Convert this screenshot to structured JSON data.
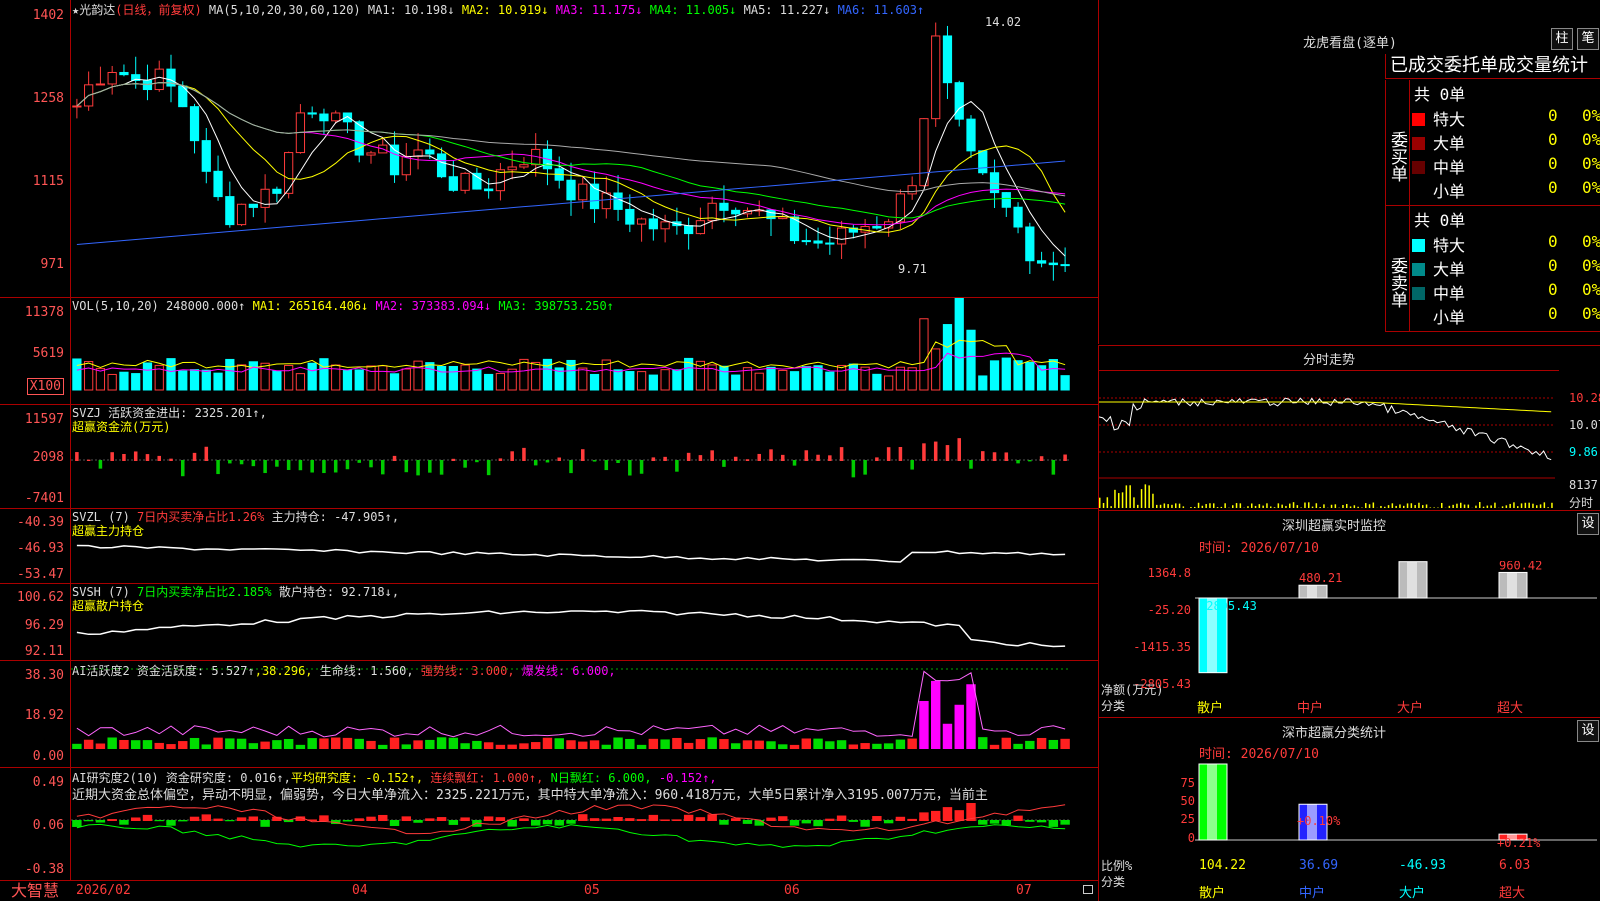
{
  "stock_title": "★光韵达",
  "period_note": "(日线，前复权)",
  "ma_header": {
    "label": "MA(5,10,20,30,60,120)",
    "ma1": "MA1: 10.198↓",
    "ma2": "MA2: 10.919↓",
    "ma3": "MA3: 11.175↓",
    "ma4": "MA4: 11.005↓",
    "ma5": "MA5: 11.227↓",
    "ma6": "MA6: 11.603↑"
  },
  "price_ticks": [
    "1402",
    "1258",
    "1115",
    "971"
  ],
  "price_high_label": "14.02",
  "price_low_label": "9.71",
  "vol_header": {
    "label": "VOL(5,10,20)",
    "vol": "248000.000↑",
    "ma1": "MA1: 265164.406↓",
    "ma2": "MA2: 373383.094↓",
    "ma3": "MA3: 398753.250↑"
  },
  "vol_ticks": [
    "11378",
    "5619",
    "X100"
  ],
  "svzj": {
    "line1": "SVZJ  活跃资金进出: 2325.201↑,",
    "line2": "超赢资金流(万元)",
    "ticks": [
      "11597",
      "2098",
      "-7401"
    ]
  },
  "svzl": {
    "label": "SVZL (7)",
    "ratio": "7日内买卖净占比1.26%",
    "value": "主力持仓: -47.905↑,",
    "line2": "超赢主力持仓",
    "ticks": [
      "-40.39",
      "-46.93",
      "-53.47"
    ]
  },
  "svsh": {
    "label": "SVSH (7)",
    "ratio": "7日内买卖净占比2.185%",
    "value": "散户持仓: 92.718↓,",
    "line2": "超赢散户持仓",
    "ticks": [
      "100.62",
      "96.29",
      "92.11"
    ]
  },
  "ai_active": {
    "label": "AI活跃度2",
    "v1": "资金活跃度: 5.527↑",
    "v2": ",38.296,",
    "v3": "生命线: 1.560,",
    "v4": "强势线: 3.000,",
    "v5": "爆发线: 6.000,",
    "ticks": [
      "38.30",
      "18.92",
      "0.00"
    ]
  },
  "ai_research": {
    "label": "AI研究度2(10)",
    "v1": "资金研究度: 0.016↑,",
    "v2": "平均研究度: -0.152↑,",
    "v3": "连续飘红: 1.000↑,",
    "v4": "N日飘红: 6.000,",
    "v5": "-0.152↑,",
    "summary": "近期大资金总体偏空，异动不明显，偏弱势，今日大单净流入：2325.221万元，其中特大单净流入：960.418万元，大单5日累计净入3195.007万元，当前主",
    "ticks": [
      "0.49",
      "0.06",
      "-0.38"
    ]
  },
  "date_axis": [
    "2026/02",
    "04",
    "05",
    "06",
    "07"
  ],
  "brand": "大智慧",
  "right": {
    "dragon_title": "龙虎看盘(逐单)",
    "btn_bar": "柱",
    "btn_pen": "笔",
    "order_stat_title": "已成交委托单成交量统计",
    "buy_label": "委买单",
    "sell_label": "委卖单",
    "buy_total": "共 0单",
    "sell_total": "共 0单",
    "buy_rows": [
      {
        "name": "特大",
        "val": "0",
        "pct": "0%",
        "color": "#ff0000"
      },
      {
        "name": "大单",
        "val": "0",
        "pct": "0%",
        "color": "#990000"
      },
      {
        "name": "中单",
        "val": "0",
        "pct": "0%",
        "color": "#660000"
      },
      {
        "name": "小单",
        "val": "0",
        "pct": "0%",
        "color": "#000000"
      }
    ],
    "sell_rows": [
      {
        "name": "特大",
        "val": "0",
        "pct": "0%",
        "color": "#00ffff"
      },
      {
        "name": "大单",
        "val": "0",
        "pct": "0%",
        "color": "#008b8b"
      },
      {
        "name": "中单",
        "val": "0",
        "pct": "0%",
        "color": "#006666"
      },
      {
        "name": "小单",
        "val": "0",
        "pct": "0%",
        "color": "#000000"
      }
    ],
    "intraday_title": "分时走势",
    "intraday_ticks": [
      "10.28",
      "10.07",
      "9.86"
    ],
    "intraday_vol_tick": "8137",
    "intraday_vol_unit": "分时",
    "sz_monitor_title": "深圳超赢实时监控",
    "sz_monitor_btn": "设",
    "sz_monitor_time": "时间: 2026/07/10",
    "sz_monitor_ticks": [
      "1364.8",
      "-25.20",
      "-1415.35",
      "-2805.43"
    ],
    "sz_monitor_ylabel1": "净额(万元)",
    "sz_monitor_ylabel2": "分类",
    "sz_monitor_cats": [
      "散户",
      "中户",
      "大户",
      "超大"
    ],
    "sz_monitor_vals_text": [
      "-2805.43",
      "480.21",
      "1364.8",
      "960.42"
    ],
    "sz_class_title": "深市超赢分类统计",
    "sz_class_btn": "设",
    "sz_class_time": "时间: 2026/07/10",
    "sz_class_ticks": [
      "75",
      "50",
      "25",
      "0"
    ],
    "sz_class_ylabel1": "比例%",
    "sz_class_ylabel2": "分类",
    "sz_class_cats": [
      "散户",
      "中户",
      "大户",
      "超大"
    ],
    "sz_class_bottom_vals": [
      "104.22",
      "36.69",
      "-46.93",
      "6.03"
    ],
    "sz_class_top_labels": [
      "+0.10%",
      "+0.21%"
    ]
  },
  "chart_data": [
    {
      "type": "bar",
      "title": "深圳超赢实时监控",
      "ylabel": "净额(万元)",
      "categories": [
        "散户",
        "中户",
        "大户",
        "超大"
      ],
      "values": [
        -2805.43,
        480.21,
        1364.8,
        960.42
      ],
      "ylim": [
        -2805.43,
        1364.8
      ]
    },
    {
      "type": "bar",
      "title": "深市超赢分类统计",
      "ylabel": "比例%",
      "categories": [
        "散户",
        "中户",
        "大户",
        "超大"
      ],
      "values": [
        104.22,
        36.69,
        -46.93,
        6.03
      ],
      "ylim": [
        0,
        75
      ]
    }
  ],
  "colors": {
    "up": "#ff3b3b",
    "down": "#00ffff",
    "axis_red": "#aa0000"
  }
}
